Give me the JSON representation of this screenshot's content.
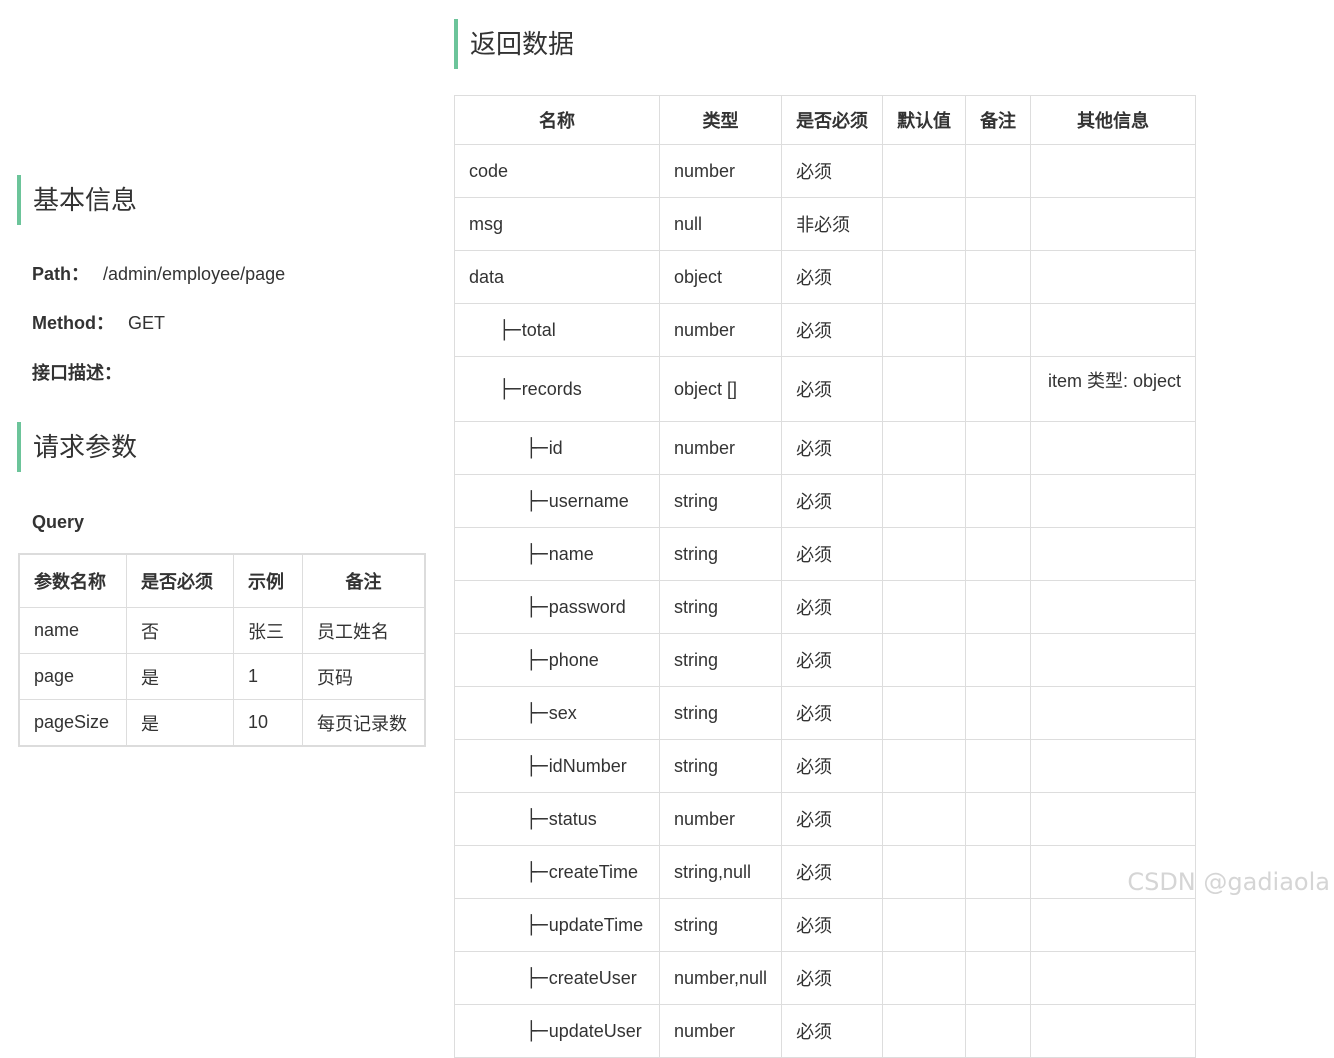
{
  "sections": {
    "basic_info": "基本信息",
    "request_params": "请求参数",
    "response_data": "返回数据"
  },
  "basic": {
    "path_label": "Path：",
    "path_value": "/admin/employee/page",
    "method_label": "Method：",
    "method_value": "GET",
    "desc_label": "接口描述："
  },
  "query": {
    "title": "Query",
    "headers": [
      "参数名称",
      "是否必须",
      "示例",
      "备注"
    ],
    "rows": [
      [
        "name",
        "否",
        "张三",
        "员工姓名"
      ],
      [
        "page",
        "是",
        "1",
        "页码"
      ],
      [
        "pageSize",
        "是",
        "10",
        "每页记录数"
      ]
    ]
  },
  "response": {
    "headers": [
      "名称",
      "类型",
      "是否必须",
      "默认值",
      "备注",
      "其他信息"
    ],
    "tree_glyph": "├─",
    "rows": [
      {
        "name": "code",
        "type": "number",
        "required": "必须",
        "other": ""
      },
      {
        "name": "msg",
        "type": "null",
        "required": "非必须",
        "other": ""
      },
      {
        "name": "data",
        "type": "object",
        "required": "必须",
        "other": ""
      },
      {
        "name": "total",
        "type": "number",
        "required": "必须",
        "other": ""
      },
      {
        "name": "records",
        "type": "object []",
        "required": "必须",
        "other": "item 类型: object"
      },
      {
        "name": "id",
        "type": "number",
        "required": "必须",
        "other": ""
      },
      {
        "name": "username",
        "type": "string",
        "required": "必须",
        "other": ""
      },
      {
        "name": "name",
        "type": "string",
        "required": "必须",
        "other": ""
      },
      {
        "name": "password",
        "type": "string",
        "required": "必须",
        "other": ""
      },
      {
        "name": "phone",
        "type": "string",
        "required": "必须",
        "other": ""
      },
      {
        "name": "sex",
        "type": "string",
        "required": "必须",
        "other": ""
      },
      {
        "name": "idNumber",
        "type": "string",
        "required": "必须",
        "other": ""
      },
      {
        "name": "status",
        "type": "number",
        "required": "必须",
        "other": ""
      },
      {
        "name": "createTime",
        "type": "string,null",
        "required": "必须",
        "other": ""
      },
      {
        "name": "updateTime",
        "type": "string",
        "required": "必须",
        "other": ""
      },
      {
        "name": "createUser",
        "type": "number,null",
        "required": "必须",
        "other": ""
      },
      {
        "name": "updateUser",
        "type": "number",
        "required": "必须",
        "other": ""
      }
    ]
  },
  "watermark": "CSDN @gadiaola"
}
